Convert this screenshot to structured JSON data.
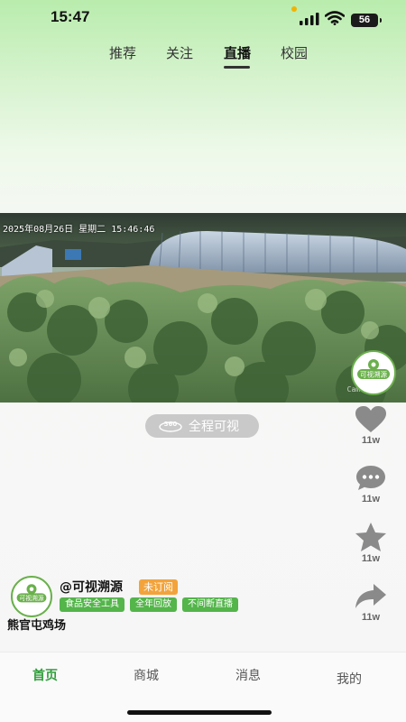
{
  "status_bar": {
    "time": "15:47",
    "battery": "56",
    "signal_icon": "signal-icon",
    "wifi_icon": "wifi-icon"
  },
  "top_tabs": [
    {
      "label": "推荐",
      "active": false
    },
    {
      "label": "关注",
      "active": false
    },
    {
      "label": "直播",
      "active": true
    },
    {
      "label": "校园",
      "active": false
    }
  ],
  "video": {
    "timestamp": "2025年08月26日  星期二  15:46:46",
    "camera_label": "Camera 07",
    "panorama_badge": "360",
    "panorama_label": "全程可视"
  },
  "brand": {
    "logo_text": "可视溯源",
    "accent": "#6ab04c"
  },
  "actions": [
    {
      "icon": "heart-icon",
      "count": "11w"
    },
    {
      "icon": "comment-icon",
      "count": "11w"
    },
    {
      "icon": "star-icon",
      "count": "11w"
    },
    {
      "icon": "share-icon",
      "count": "11w"
    }
  ],
  "author": {
    "handle": "@可视溯源",
    "subscribe_status": "未订阅",
    "tags": [
      "食品安全工具",
      "全年回放",
      "不间断直播"
    ],
    "farm_name": "熊官屯鸡场"
  },
  "bottom_nav": [
    {
      "label": "首页",
      "active": true
    },
    {
      "label": "商城",
      "active": false
    },
    {
      "label": "消息",
      "active": false
    },
    {
      "label": "我的",
      "active": false
    }
  ],
  "colors": {
    "primary_green": "#2f9d3a",
    "tag_green": "#53b54a",
    "badge_orange": "#f3a33b"
  }
}
